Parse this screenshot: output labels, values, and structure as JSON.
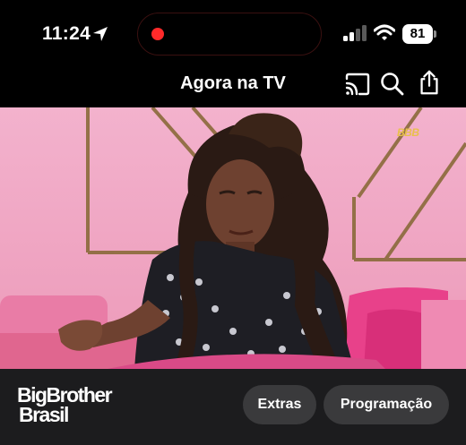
{
  "status_bar": {
    "time": "11:24",
    "battery": "81"
  },
  "header": {
    "title": "Agora na TV"
  },
  "video": {
    "channel_logo": "BBB"
  },
  "bottom_bar": {
    "brand_line1": "BigBrother",
    "brand_line2": "Brasil",
    "buttons": [
      {
        "label": "Extras"
      },
      {
        "label": "Programação"
      }
    ]
  },
  "icons": {
    "cast": "cast-icon",
    "search": "search-icon",
    "share": "share-icon"
  },
  "colors": {
    "recording": "#ff2a2a",
    "wall_pink": "#f2a6c4",
    "bottom_bar": "#1c1c1e",
    "pill": "#3a3a3c"
  }
}
